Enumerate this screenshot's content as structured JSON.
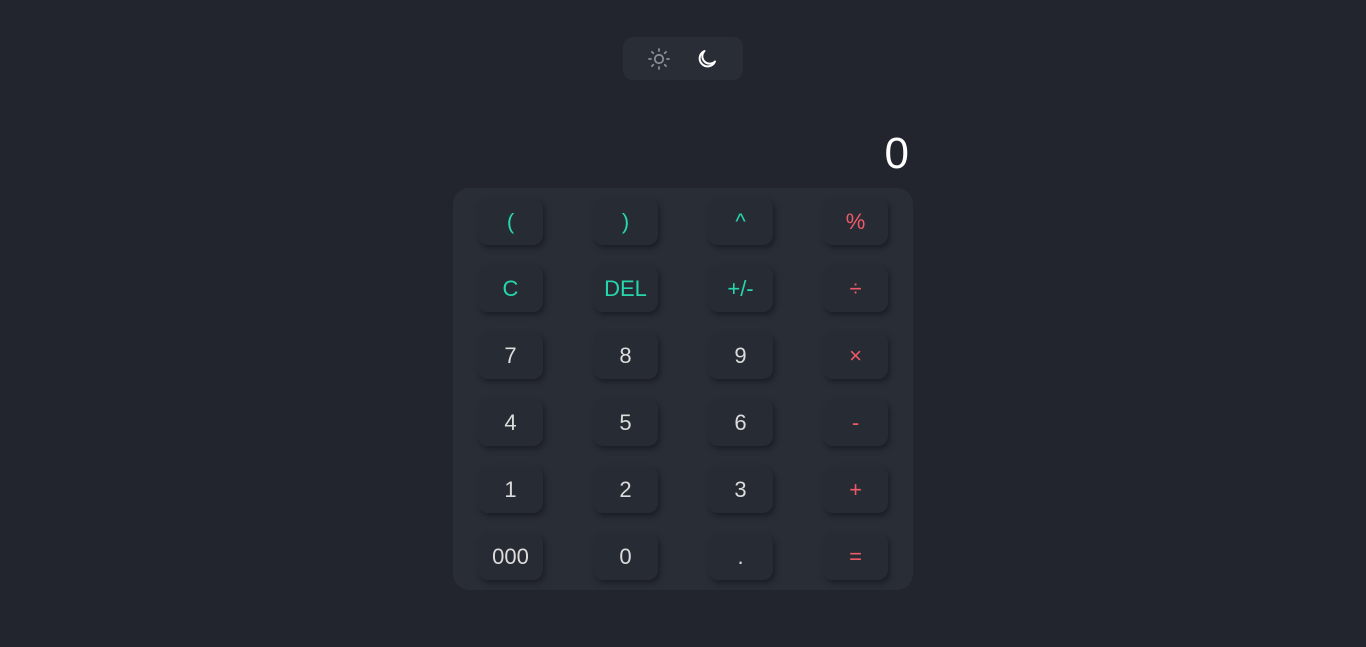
{
  "theme_toggle": {
    "light_icon": "sun-icon",
    "dark_icon": "moon-icon"
  },
  "display": {
    "value": "0"
  },
  "keypad": {
    "rows": [
      [
        "(",
        ")",
        "^",
        "%"
      ],
      [
        "C",
        "DEL",
        "+/-",
        "÷"
      ],
      [
        "7",
        "8",
        "9",
        "×"
      ],
      [
        "4",
        "5",
        "6",
        "-"
      ],
      [
        "1",
        "2",
        "3",
        "+"
      ],
      [
        "000",
        "0",
        ".",
        "="
      ]
    ]
  },
  "colors": {
    "background": "#22252d",
    "panel": "#292d36",
    "function_key": "#26d7ae",
    "operator_key": "#ef5a68",
    "digit_key": "#dcdcdc",
    "display_text": "#ffffff"
  }
}
